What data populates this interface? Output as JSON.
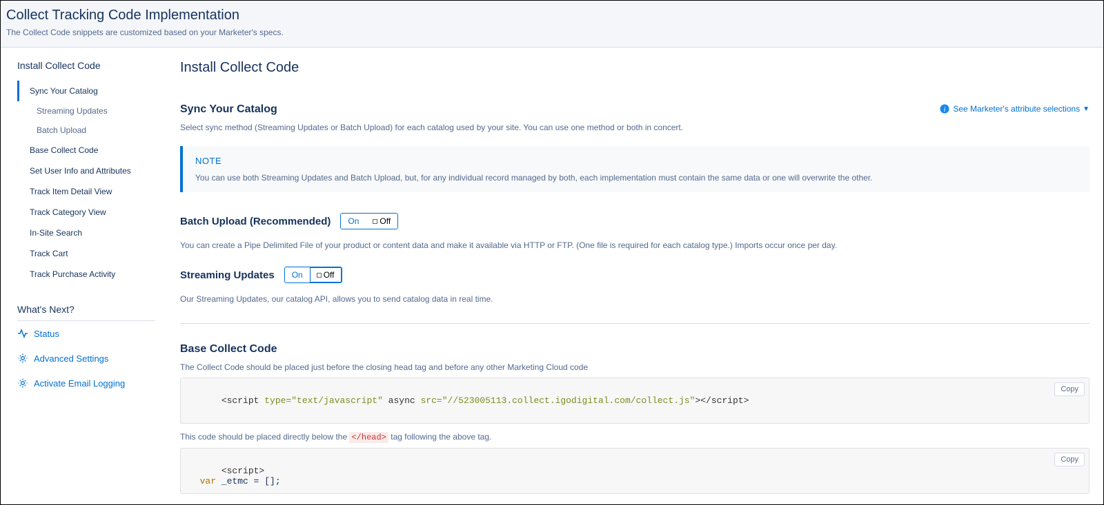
{
  "header": {
    "title": "Collect Tracking Code Implementation",
    "subtitle": "The Collect Code snippets are customized based on your Marketer's specs."
  },
  "sidebar": {
    "section_title": "Install Collect Code",
    "items": [
      {
        "label": "Sync Your Catalog",
        "active": true
      },
      {
        "label": "Streaming Updates",
        "child": true
      },
      {
        "label": "Batch Upload",
        "child": true
      },
      {
        "label": "Base Collect Code"
      },
      {
        "label": "Set User Info and Attributes"
      },
      {
        "label": "Track Item Detail View"
      },
      {
        "label": "Track Category View"
      },
      {
        "label": "In-Site Search"
      },
      {
        "label": "Track Cart"
      },
      {
        "label": "Track Purchase Activity"
      }
    ],
    "whats_next_heading": "What's Next?",
    "whats_next": [
      {
        "label": "Status",
        "icon": "pulse"
      },
      {
        "label": "Advanced Settings",
        "icon": "gear"
      },
      {
        "label": "Activate Email Logging",
        "icon": "gear"
      }
    ]
  },
  "main": {
    "title": "Install Collect Code",
    "sync": {
      "heading": "Sync Your Catalog",
      "desc": "Select sync method (Streaming Updates or Batch Upload) for each catalog used by your site. You can use one method or both in concert.",
      "link": "See Marketer's attribute selections"
    },
    "note": {
      "title": "NOTE",
      "text": "You can use both Streaming Updates and Batch Upload, but, for any individual record managed by both, each implementation must contain the same data or one will overwrite the other."
    },
    "batch": {
      "heading": "Batch Upload (Recommended)",
      "on_label": "On",
      "off_label": "Off",
      "state": "on",
      "desc": "You can create a Pipe Delimited File of your product or content data and make it available via HTTP or FTP. (One file is required for each catalog type.) Imports occur once per day."
    },
    "streaming": {
      "heading": "Streaming Updates",
      "on_label": "On",
      "off_label": "Off",
      "state": "off",
      "desc": "Our Streaming Updates, our catalog API, allows you to send catalog data in real time."
    },
    "base": {
      "heading": "Base Collect Code",
      "desc1": "The Collect Code should be placed just before the closing head tag and before any other Marketing Cloud code",
      "copy_label": "Copy",
      "code1": "<script type=\"text/javascript\" async src=\"//523005113.collect.igodigital.com/collect.js\"></script>",
      "desc2_pre": "This code should be placed directly below the ",
      "desc2_code": "</head>",
      "desc2_post": " tag following the above tag.",
      "code2": "<script>\n  var _etmc = [];"
    }
  }
}
